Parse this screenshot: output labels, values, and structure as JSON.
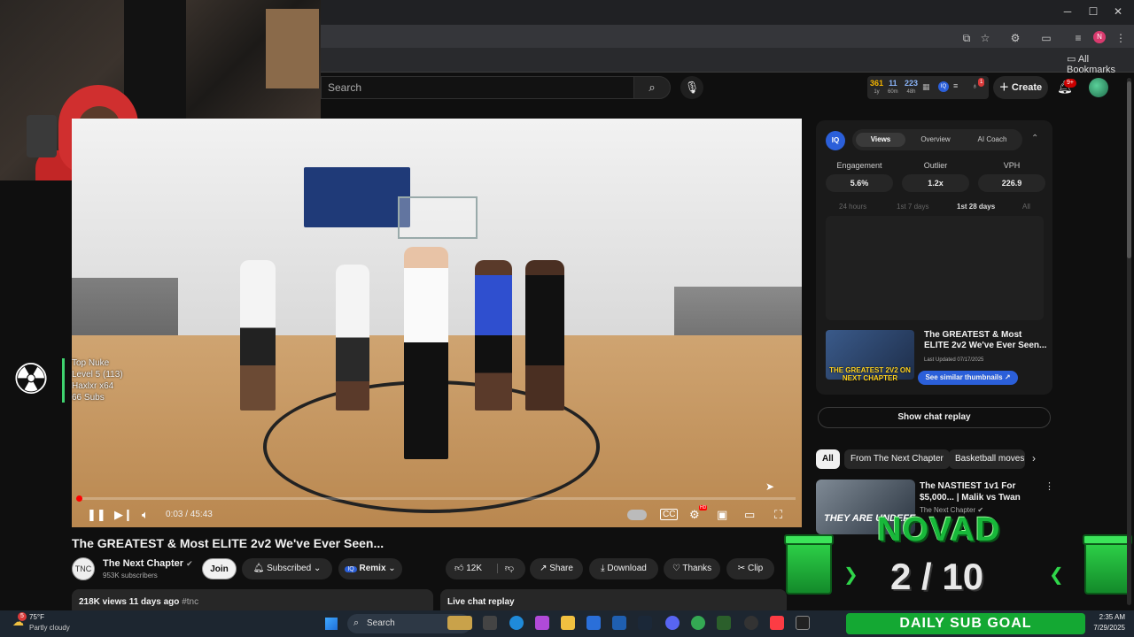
{
  "browser": {
    "bookmarks_label": "All Bookmarks",
    "profile_initial": "N",
    "window_controls": [
      "─",
      "☐",
      "✕"
    ]
  },
  "youtube": {
    "search_placeholder": "Search",
    "stats": [
      {
        "value": "361",
        "sub": "1y",
        "color": "#f4b400"
      },
      {
        "value": "11",
        "sub": "60m",
        "color": "#8ab4f8"
      },
      {
        "value": "223",
        "sub": "48h",
        "color": "#8ab4f8"
      }
    ],
    "notif_count_small": "1",
    "create_label": "Create",
    "notifications_badge": "9+"
  },
  "player": {
    "time": "0:03 / 45:43",
    "progress_fraction": 0.001,
    "hd_badge": "HD"
  },
  "nuke_overlay": {
    "lines": [
      "Top Nuke",
      "Level 5  (113)",
      "Haxlxr x64",
      "66 Subs"
    ]
  },
  "video": {
    "title": "The GREATEST & Most ELITE 2v2 We've Ever Seen...",
    "channel_name": "The Next Chapter",
    "channel_initials": "TNC",
    "subscribers": "953K subscribers",
    "join_label": "Join",
    "subscribed_label": "Subscribed",
    "remix_label": "Remix",
    "likes": "12K",
    "share_label": "Share",
    "download_label": "Download",
    "thanks_label": "Thanks",
    "clip_label": "Clip",
    "views_line": "218K views  11 days ago",
    "hashtag": "#tnc",
    "live_chat_label": "Live chat replay"
  },
  "iq_panel": {
    "logo": "IQ",
    "tabs": [
      "Views",
      "Overview",
      "AI Coach"
    ],
    "active_tab": 0,
    "metrics": [
      {
        "label": "Engagement",
        "value": "5.6%"
      },
      {
        "label": "Outlier",
        "value": "1.2x"
      },
      {
        "label": "VPH",
        "value": "226.9"
      }
    ],
    "ranges": [
      "24 hours",
      "1st 7 days",
      "1st 28 days",
      "All"
    ],
    "active_range": 2,
    "thumb_title": "The GREATEST & Most ELITE 2v2 We've Ever Seen...",
    "thumb_text": "THE GREATEST 2V2 ON NEXT CHAPTER",
    "last_updated": "Last Updated 07/17/2025",
    "similar_label": "See similar thumbnails ↗"
  },
  "sidebar": {
    "chat_replay_label": "Show chat replay",
    "chips": [
      "All",
      "From The Next Chapter",
      "Basketball moves"
    ],
    "recommendation": {
      "title": "The NASTIEST 1v1 For $5,000... | Malik vs Twan",
      "channel": "The Next Chapter",
      "thumb_text": "THEY ARE UNDEFE"
    }
  },
  "sub_goal": {
    "name": "NOVAD",
    "current": "2",
    "goal": "10",
    "label": "DAILY SUB GOAL"
  },
  "taskbar": {
    "temperature": "75°F",
    "condition": "Partly cloudy",
    "weather_badge": "5",
    "search_label": "Search",
    "time": "2:35 AM",
    "date": "7/29/2025"
  }
}
